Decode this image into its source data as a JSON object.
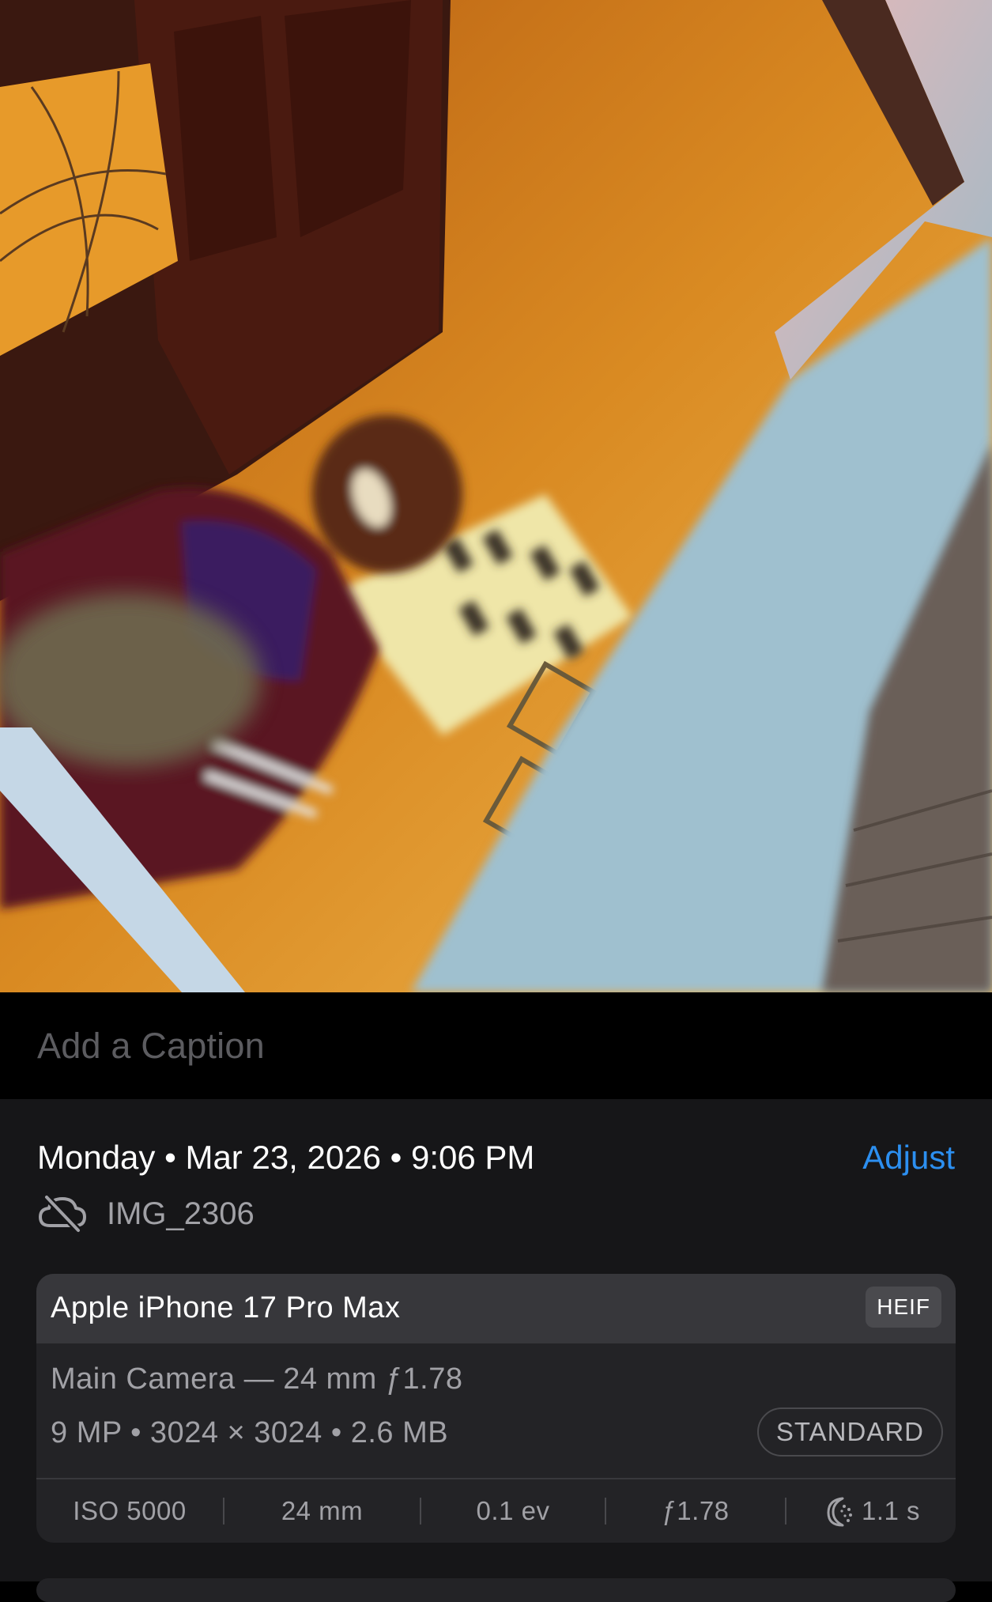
{
  "photo": {
    "alt_icon": "photo-preview"
  },
  "caption": {
    "placeholder": "Add a Caption"
  },
  "info": {
    "date_line": "Monday • Mar 23, 2026 • 9:06 PM",
    "adjust_label": "Adjust",
    "cloud_icon": "cloud-slash-icon",
    "filename": "IMG_2306"
  },
  "card": {
    "device": "Apple iPhone 17 Pro Max",
    "format": "HEIF",
    "lens": "Main Camera — 24 mm ƒ1.78",
    "specs": "9 MP • 3024 × 3024 • 2.6 MB",
    "profile": "STANDARD",
    "exif": {
      "iso": "ISO 5000",
      "focal": "24 mm",
      "ev": "0.1 ev",
      "aperture": "ƒ1.78",
      "shutter": "1.1 s",
      "shutter_icon": "night-mode-icon"
    }
  },
  "colors": {
    "accent": "#2c8ff0",
    "panel": "#161618",
    "card": "#232326",
    "card_header": "#37373b"
  }
}
